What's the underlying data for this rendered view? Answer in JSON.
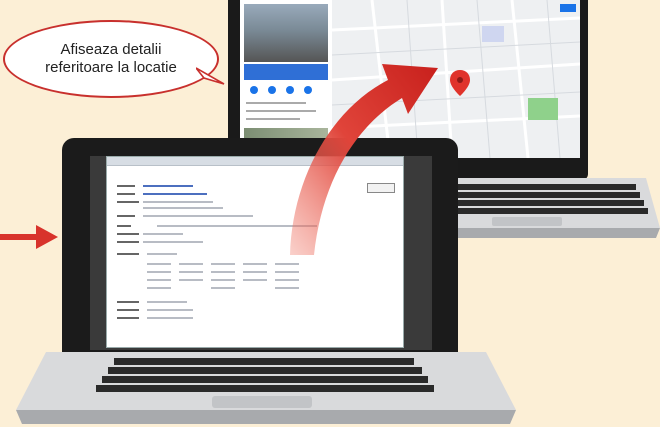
{
  "callout": {
    "line1": "Afiseaza detalii",
    "line2": "referitoare la locatie"
  },
  "colors": {
    "background": "#fcefd6",
    "accent_red": "#d8332c",
    "laptop_body": "#d9dadc",
    "bezel": "#1b1b1b",
    "map_pin": "#e0332b",
    "map_park": "#8fd18b",
    "map_link_blue": "#1a73e8"
  },
  "icons": {
    "left_arrow": "arrow-right-icon",
    "transition_arrow": "curved-arrow-icon",
    "map_pin": "map-pin-icon"
  }
}
